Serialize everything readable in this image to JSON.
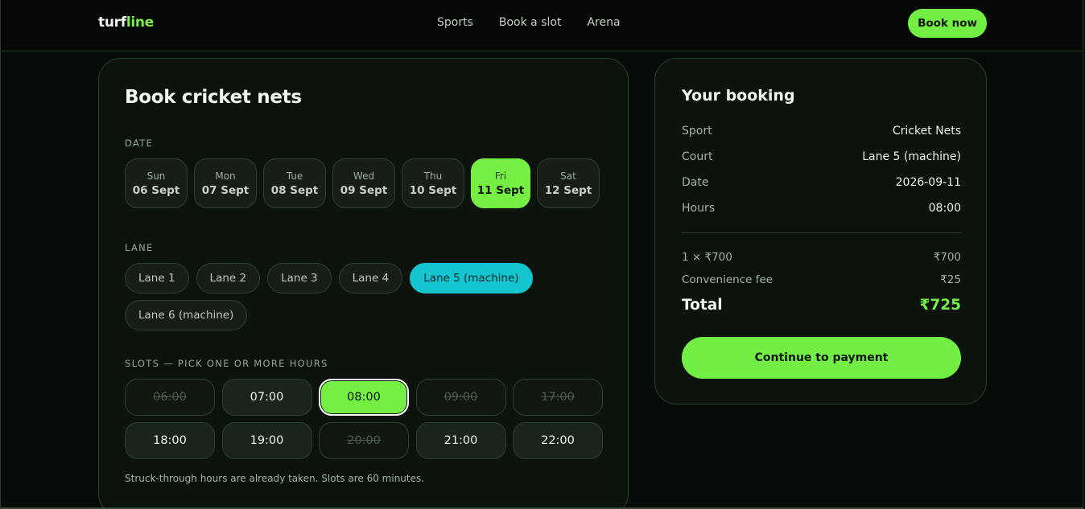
{
  "header": {
    "logo_main": "turf",
    "logo_accent": "line",
    "nav": [
      "Sports",
      "Book a slot",
      "Arena"
    ],
    "cta": "Book now"
  },
  "booking_form": {
    "title": "Book cricket nets",
    "date_label": "DATE",
    "dates": [
      {
        "dow": "Sun",
        "date": "06 Sept",
        "selected": false
      },
      {
        "dow": "Mon",
        "date": "07 Sept",
        "selected": false
      },
      {
        "dow": "Tue",
        "date": "08 Sept",
        "selected": false
      },
      {
        "dow": "Wed",
        "date": "09 Sept",
        "selected": false
      },
      {
        "dow": "Thu",
        "date": "10 Sept",
        "selected": false
      },
      {
        "dow": "Fri",
        "date": "11 Sept",
        "selected": true
      },
      {
        "dow": "Sat",
        "date": "12 Sept",
        "selected": false
      }
    ],
    "lane_label": "LANE",
    "lanes": [
      {
        "label": "Lane 1",
        "selected": false
      },
      {
        "label": "Lane 2",
        "selected": false
      },
      {
        "label": "Lane 3",
        "selected": false
      },
      {
        "label": "Lane 4",
        "selected": false
      },
      {
        "label": "Lane 5 (machine)",
        "selected": true
      },
      {
        "label": "Lane 6 (machine)",
        "selected": false
      }
    ],
    "slots_label": "SLOTS — PICK ONE OR MORE HOURS",
    "slots": [
      {
        "time": "06:00",
        "state": "taken"
      },
      {
        "time": "07:00",
        "state": "available"
      },
      {
        "time": "08:00",
        "state": "selected"
      },
      {
        "time": "09:00",
        "state": "taken"
      },
      {
        "time": "17:00",
        "state": "taken"
      },
      {
        "time": "18:00",
        "state": "available"
      },
      {
        "time": "19:00",
        "state": "available"
      },
      {
        "time": "20:00",
        "state": "taken"
      },
      {
        "time": "21:00",
        "state": "available"
      },
      {
        "time": "22:00",
        "state": "available"
      }
    ],
    "hint": "Struck-through hours are already taken. Slots are 60 minutes."
  },
  "summary": {
    "title": "Your booking",
    "details": [
      {
        "key": "Sport",
        "value": "Cricket Nets"
      },
      {
        "key": "Court",
        "value": "Lane 5 (machine)"
      },
      {
        "key": "Date",
        "value": "2026-09-11"
      },
      {
        "key": "Hours",
        "value": "08:00"
      }
    ],
    "line_item": {
      "key": "1 × ₹700",
      "value": "₹700"
    },
    "fee": {
      "key": "Convenience fee",
      "value": "₹25"
    },
    "total": {
      "key": "Total",
      "value": "₹725"
    },
    "pay_button": "Continue to payment"
  },
  "colors": {
    "accent_green": "#72ee45",
    "selected_lane": "#14c4cf",
    "background": "#070b07"
  }
}
